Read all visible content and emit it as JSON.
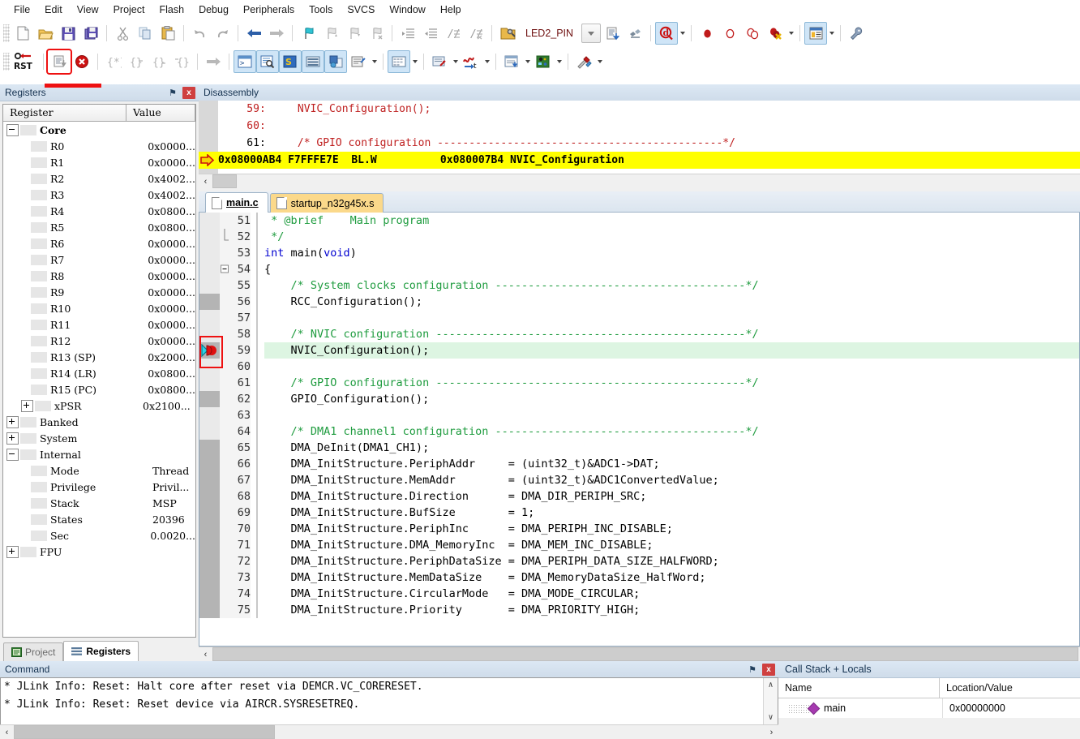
{
  "menu": {
    "items": [
      "File",
      "Edit",
      "View",
      "Project",
      "Flash",
      "Debug",
      "Peripherals",
      "Tools",
      "SVCS",
      "Window",
      "Help"
    ]
  },
  "toolbar1": {
    "icons": [
      "new-file-icon",
      "open-folder-icon",
      "save-icon",
      "save-all-icon",
      "cut-icon",
      "copy-icon",
      "paste-icon",
      "undo-icon",
      "redo-icon",
      "navigate-back-icon",
      "navigate-forward-icon",
      "bookmark-toggle-icon",
      "bookmark-prev-icon",
      "bookmark-next-icon",
      "bookmark-clear-icon",
      "indent-icon",
      "outdent-icon",
      "comment-icon",
      "uncomment-icon"
    ],
    "target_label": "LED2_PIN",
    "after_icons": [
      "find-in-files-icon",
      "build-target-icon",
      "debug-start-icon",
      "breakpoint-insert-icon",
      "breakpoint-disable-icon",
      "breakpoint-disable-all-icon",
      "breakpoint-kill-all-icon",
      "manage-windows-icon",
      "configure-icon"
    ]
  },
  "toolbar2": {
    "reset_label": "RST",
    "icons": [
      "reset-cpu-icon",
      "run-icon",
      "stop-icon",
      "step-icon",
      "step-over-icon",
      "step-out-icon",
      "run-to-cursor-icon",
      "show-next-statement-icon",
      "command-window-icon",
      "disassembly-window-icon",
      "symbols-window-icon",
      "registers-window-icon",
      "call-stack-window-icon",
      "watch-window-icon",
      "memory-window-icon",
      "serial-window-icon",
      "analysis-window-icon",
      "trace-icon",
      "system-viewer-icon",
      "toolbox-icon"
    ]
  },
  "registers_pane": {
    "title": "Registers",
    "pin_glyph": "⚑",
    "close_glyph": "x",
    "columns": [
      "Register",
      "Value"
    ],
    "rows": [
      {
        "name": "Core",
        "value": "",
        "level": 0,
        "twisty": "minus",
        "bold": true
      },
      {
        "name": "R0",
        "value": "0x0000...",
        "level": 2,
        "twisty": "none"
      },
      {
        "name": "R1",
        "value": "0x0000...",
        "level": 2,
        "twisty": "none"
      },
      {
        "name": "R2",
        "value": "0x4002...",
        "level": 2,
        "twisty": "none"
      },
      {
        "name": "R3",
        "value": "0x4002...",
        "level": 2,
        "twisty": "none"
      },
      {
        "name": "R4",
        "value": "0x0800...",
        "level": 2,
        "twisty": "none"
      },
      {
        "name": "R5",
        "value": "0x0800...",
        "level": 2,
        "twisty": "none"
      },
      {
        "name": "R6",
        "value": "0x0000...",
        "level": 2,
        "twisty": "none"
      },
      {
        "name": "R7",
        "value": "0x0000...",
        "level": 2,
        "twisty": "none"
      },
      {
        "name": "R8",
        "value": "0x0000...",
        "level": 2,
        "twisty": "none"
      },
      {
        "name": "R9",
        "value": "0x0000...",
        "level": 2,
        "twisty": "none"
      },
      {
        "name": "R10",
        "value": "0x0000...",
        "level": 2,
        "twisty": "none"
      },
      {
        "name": "R11",
        "value": "0x0000...",
        "level": 2,
        "twisty": "none"
      },
      {
        "name": "R12",
        "value": "0x0000...",
        "level": 2,
        "twisty": "none"
      },
      {
        "name": "R13 (SP)",
        "value": "0x2000...",
        "level": 2,
        "twisty": "none"
      },
      {
        "name": "R14 (LR)",
        "value": "0x0800...",
        "level": 2,
        "twisty": "none"
      },
      {
        "name": "R15 (PC)",
        "value": "0x0800...",
        "level": 2,
        "twisty": "none"
      },
      {
        "name": "xPSR",
        "value": "0x2100...",
        "level": 1,
        "twisty": "plus"
      },
      {
        "name": "Banked",
        "value": "",
        "level": 0,
        "twisty": "plus"
      },
      {
        "name": "System",
        "value": "",
        "level": 0,
        "twisty": "plus"
      },
      {
        "name": "Internal",
        "value": "",
        "level": 0,
        "twisty": "minus"
      },
      {
        "name": "Mode",
        "value": "Thread",
        "level": 2,
        "twisty": "none"
      },
      {
        "name": "Privilege",
        "value": "Privil...",
        "level": 2,
        "twisty": "none"
      },
      {
        "name": "Stack",
        "value": "MSP",
        "level": 2,
        "twisty": "none"
      },
      {
        "name": "States",
        "value": "20396",
        "level": 2,
        "twisty": "none"
      },
      {
        "name": "Sec",
        "value": "0.0020...",
        "level": 2,
        "twisty": "none"
      },
      {
        "name": "FPU",
        "value": "",
        "level": 0,
        "twisty": "plus"
      }
    ],
    "tabs": [
      {
        "label": "Project",
        "selected": false,
        "icon": "project-icon"
      },
      {
        "label": "Registers",
        "selected": true,
        "icon": "registers-icon"
      }
    ]
  },
  "disassembly": {
    "title": "Disassembly",
    "lines": [
      {
        "text": "    59:     NVIC_Configuration();",
        "highlight": false,
        "kind": "src"
      },
      {
        "text": "    60:",
        "highlight": false,
        "kind": "src"
      },
      {
        "text": "    61:     /* GPIO configuration ---------------------------------------------*/",
        "highlight": false,
        "kind": "src"
      },
      {
        "text": "0x08000AB4 F7FFFE7E  BL.W          0x080007B4 NVIC_Configuration",
        "highlight": true,
        "kind": "asm"
      }
    ]
  },
  "editor": {
    "tabs": [
      {
        "label": "main.c",
        "selected": true
      },
      {
        "label": "startup_n32g45x.s",
        "selected": false
      }
    ],
    "current_line": 59,
    "lines": [
      {
        "no": 51,
        "text": " * @brief    Main program",
        "kind": "comment",
        "mark": false
      },
      {
        "no": 52,
        "text": " */",
        "kind": "comment",
        "mark": false,
        "fold": "end"
      },
      {
        "no": 53,
        "text": "int main(void)",
        "kind": "code",
        "mark": false
      },
      {
        "no": 54,
        "text": "{",
        "kind": "code",
        "mark": false,
        "fold": "start"
      },
      {
        "no": 55,
        "text": "    /* System clocks configuration --------------------------------------*/",
        "kind": "comment",
        "mark": false
      },
      {
        "no": 56,
        "text": "    RCC_Configuration();",
        "kind": "code",
        "mark": true
      },
      {
        "no": 57,
        "text": "",
        "kind": "code",
        "mark": false
      },
      {
        "no": 58,
        "text": "    /* NVIC configuration -----------------------------------------------*/",
        "kind": "comment",
        "mark": false
      },
      {
        "no": 59,
        "text": "    NVIC_Configuration();",
        "kind": "code",
        "mark": true,
        "pc": true
      },
      {
        "no": 60,
        "text": "",
        "kind": "code",
        "mark": false
      },
      {
        "no": 61,
        "text": "    /* GPIO configuration -----------------------------------------------*/",
        "kind": "comment",
        "mark": false
      },
      {
        "no": 62,
        "text": "    GPIO_Configuration();",
        "kind": "code",
        "mark": true
      },
      {
        "no": 63,
        "text": "",
        "kind": "code",
        "mark": false
      },
      {
        "no": 64,
        "text": "    /* DMA1 channel1 configuration --------------------------------------*/",
        "kind": "comment",
        "mark": false
      },
      {
        "no": 65,
        "text": "    DMA_DeInit(DMA1_CH1);",
        "kind": "code",
        "mark": true
      },
      {
        "no": 66,
        "text": "    DMA_InitStructure.PeriphAddr     = (uint32_t)&ADC1->DAT;",
        "kind": "code",
        "mark": true
      },
      {
        "no": 67,
        "text": "    DMA_InitStructure.MemAddr        = (uint32_t)&ADC1ConvertedValue;",
        "kind": "code",
        "mark": true
      },
      {
        "no": 68,
        "text": "    DMA_InitStructure.Direction      = DMA_DIR_PERIPH_SRC;",
        "kind": "code",
        "mark": true
      },
      {
        "no": 69,
        "text": "    DMA_InitStructure.BufSize        = 1;",
        "kind": "code",
        "mark": true
      },
      {
        "no": 70,
        "text": "    DMA_InitStructure.PeriphInc      = DMA_PERIPH_INC_DISABLE;",
        "kind": "code",
        "mark": true
      },
      {
        "no": 71,
        "text": "    DMA_InitStructure.DMA_MemoryInc  = DMA_MEM_INC_DISABLE;",
        "kind": "code",
        "mark": true
      },
      {
        "no": 72,
        "text": "    DMA_InitStructure.PeriphDataSize = DMA_PERIPH_DATA_SIZE_HALFWORD;",
        "kind": "code",
        "mark": true
      },
      {
        "no": 73,
        "text": "    DMA_InitStructure.MemDataSize    = DMA_MemoryDataSize_HalfWord;",
        "kind": "code",
        "mark": true
      },
      {
        "no": 74,
        "text": "    DMA_InitStructure.CircularMode   = DMA_MODE_CIRCULAR;",
        "kind": "code",
        "mark": true
      },
      {
        "no": 75,
        "text": "    DMA_InitStructure.Priority       = DMA_PRIORITY_HIGH;",
        "kind": "code",
        "mark": true
      }
    ]
  },
  "command_pane": {
    "title": "Command",
    "pin_glyph": "⚑",
    "close_glyph": "x",
    "lines": [
      "* JLink Info: Reset: Halt core after reset via DEMCR.VC_CORERESET.",
      "* JLink Info: Reset: Reset device via AIRCR.SYSRESETREQ."
    ]
  },
  "call_stack_pane": {
    "title": "Call Stack + Locals",
    "columns": [
      "Name",
      "Location/Value"
    ],
    "rows": [
      {
        "name": "main",
        "value": "0x00000000"
      }
    ]
  },
  "colors": {
    "highlight_pc_disasm": "#ffff00",
    "highlight_current_line": "#ddf5e2",
    "comment_green": "#1f9c3f",
    "keyword_blue": "#0000d0",
    "disasm_comment_red": "#bf2020",
    "accent_red_box": "#ee1111",
    "titlebar_blue": "#cfdcea"
  }
}
